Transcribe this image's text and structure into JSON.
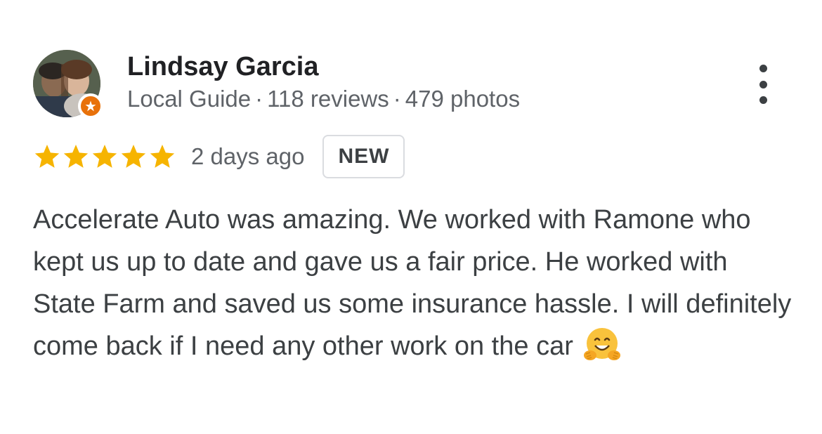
{
  "reviewer": {
    "name": "Lindsay Garcia",
    "role": "Local Guide",
    "separator": "·",
    "reviews": "118 reviews",
    "photos": "479 photos"
  },
  "rating": {
    "stars": 5,
    "date": "2 days ago",
    "badge": "NEW"
  },
  "review": {
    "text": "Accelerate Auto was amazing. We worked with Ramone who kept us up to date and gave us a fair price. He worked with State Farm and saved us some insurance hassle. I will definitely come back if I need any other work on the car"
  },
  "icons": {
    "menu": "more-vert-icon",
    "badge": "local-guide-star-icon",
    "emoji": "hugging-face-emoji"
  },
  "colors": {
    "star": "#F6B400",
    "guide_badge": "#E8710A",
    "text_primary": "#202124",
    "text_secondary": "#5F6368"
  }
}
